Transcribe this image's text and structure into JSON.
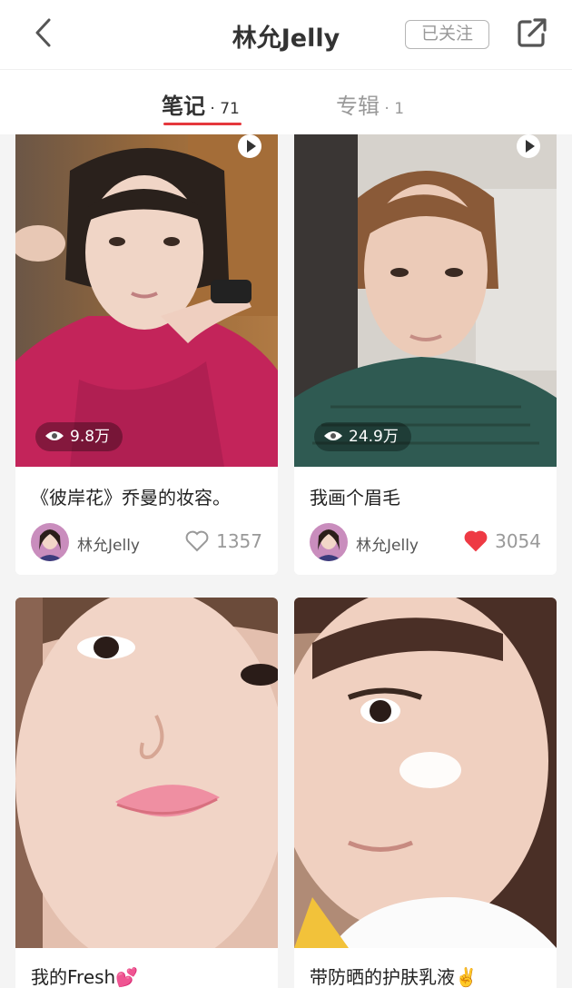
{
  "header": {
    "title": "林允Jelly",
    "follow_label": "已关注",
    "back_icon": "chevron-left-icon",
    "share_icon": "share-icon"
  },
  "tabs": [
    {
      "label": "笔记",
      "count": " · 71",
      "active": true
    },
    {
      "label": "专辑",
      "count": " · 1",
      "active": false
    }
  ],
  "colors": {
    "accent": "#e5383d",
    "like_red": "#ee3a44"
  },
  "notes": [
    {
      "title": "《彼岸花》乔曼的妆容。",
      "views": "9.8万",
      "is_video": true,
      "author": "林允Jelly",
      "likes": "1357",
      "liked": false
    },
    {
      "title": "我画个眉毛",
      "views": "24.9万",
      "is_video": true,
      "author": "林允Jelly",
      "likes": "3054",
      "liked": true
    },
    {
      "title": "我的Fresh💕",
      "is_video": false
    },
    {
      "title": "带防晒的护肤乳液✌️",
      "is_video": false
    }
  ]
}
